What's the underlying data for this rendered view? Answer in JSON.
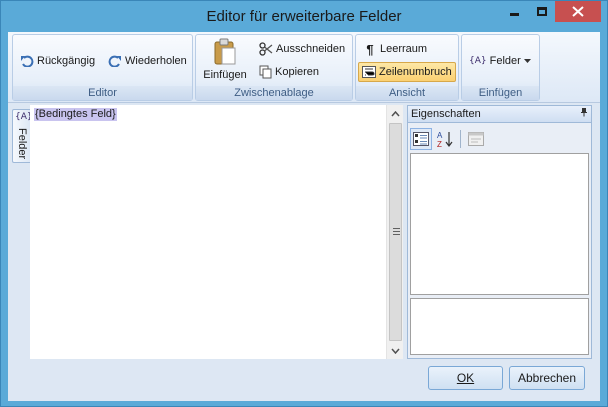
{
  "window": {
    "title": "Editor für erweiterbare Felder",
    "close_color": "#c75050"
  },
  "ribbon": {
    "groups": {
      "editor": {
        "label": "Editor",
        "undo_label": "Rückgängig",
        "redo_label": "Wiederholen"
      },
      "clipboard": {
        "label": "Zwischenablage",
        "paste_label": "Einfügen",
        "cut_label": "Ausschneiden",
        "copy_label": "Kopieren"
      },
      "view": {
        "label": "Ansicht",
        "whitespace_label": "Leerraum",
        "wordwrap_label": "Zeilenumbruch",
        "wordwrap_active": true
      },
      "insert": {
        "label": "Einfügen",
        "fields_label": "Felder",
        "fields_icon_text": "{A}"
      }
    }
  },
  "sidetab": {
    "label": "Felder",
    "icon_text": "{A}"
  },
  "editor": {
    "content_field": "{Bedingtes Feld}"
  },
  "properties": {
    "title": "Eigenschaften",
    "pin_glyph": "ᵖ",
    "sort_icon_text": "AZ"
  },
  "buttons": {
    "ok_label": "OK",
    "cancel_label": "Abbrechen"
  },
  "colors": {
    "accent": "#5aaad8",
    "field_highlight": "#c9c4ef",
    "active_button": "#fbd071"
  }
}
